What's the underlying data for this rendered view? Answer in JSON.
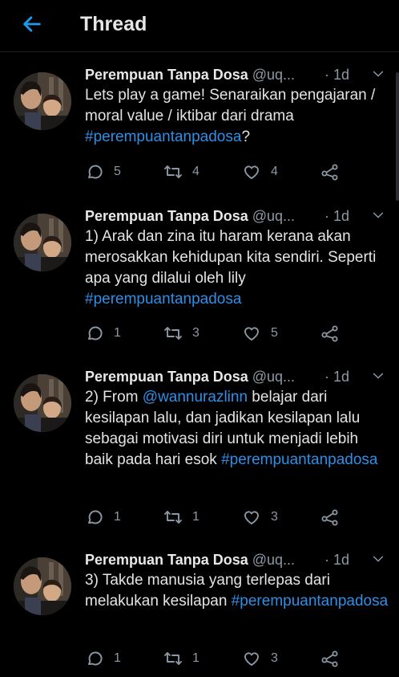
{
  "header": {
    "title": "Thread",
    "back_icon": "arrow-left-icon",
    "accent": "#1d9bf0"
  },
  "colors": {
    "background": "#000000",
    "link": "#2f8fe6",
    "muted": "#8b98a5"
  },
  "tweets": [
    {
      "name": "Perempuan Tanpa Dosa",
      "handle": "@uq...",
      "time": "· 1d",
      "text_before": "Lets play a game! Senaraikan pengajaran / moral value /  iktibar dari drama ",
      "mention": "",
      "text_middle": "",
      "hashtag": "#perempuantanpadosa",
      "text_after": "?",
      "replies": "5",
      "retweets": "4",
      "likes": "4"
    },
    {
      "name": "Perempuan Tanpa Dosa",
      "handle": "@uq...",
      "time": "· 1d",
      "text_before": "1) Arak dan zina itu haram kerana akan merosakkan kehidupan kita sendiri. Seperti apa yang dilalui oleh lily ",
      "mention": "",
      "text_middle": "",
      "hashtag": "#perempuantanpadosa",
      "text_after": "",
      "replies": "1",
      "retweets": "3",
      "likes": "5"
    },
    {
      "name": "Perempuan Tanpa Dosa",
      "handle": "@uq...",
      "time": "· 1d",
      "text_before": "2) From ",
      "mention": "@wannurazlinn",
      "text_middle": " belajar dari kesilapan lalu, dan jadikan kesilapan lalu sebagai motivasi diri untuk menjadi lebih baik pada hari esok ",
      "hashtag": "#perempuantanpadosa",
      "text_after": "",
      "replies": "1",
      "retweets": "1",
      "likes": "3"
    },
    {
      "name": "Perempuan Tanpa Dosa",
      "handle": "@uq...",
      "time": "· 1d",
      "text_before": "3) Takde manusia yang terlepas dari melakukan kesilapan ",
      "mention": "",
      "text_middle": "",
      "hashtag": "#perempuantanpadosa",
      "text_after": "",
      "replies": "1",
      "retweets": "1",
      "likes": "3"
    }
  ]
}
